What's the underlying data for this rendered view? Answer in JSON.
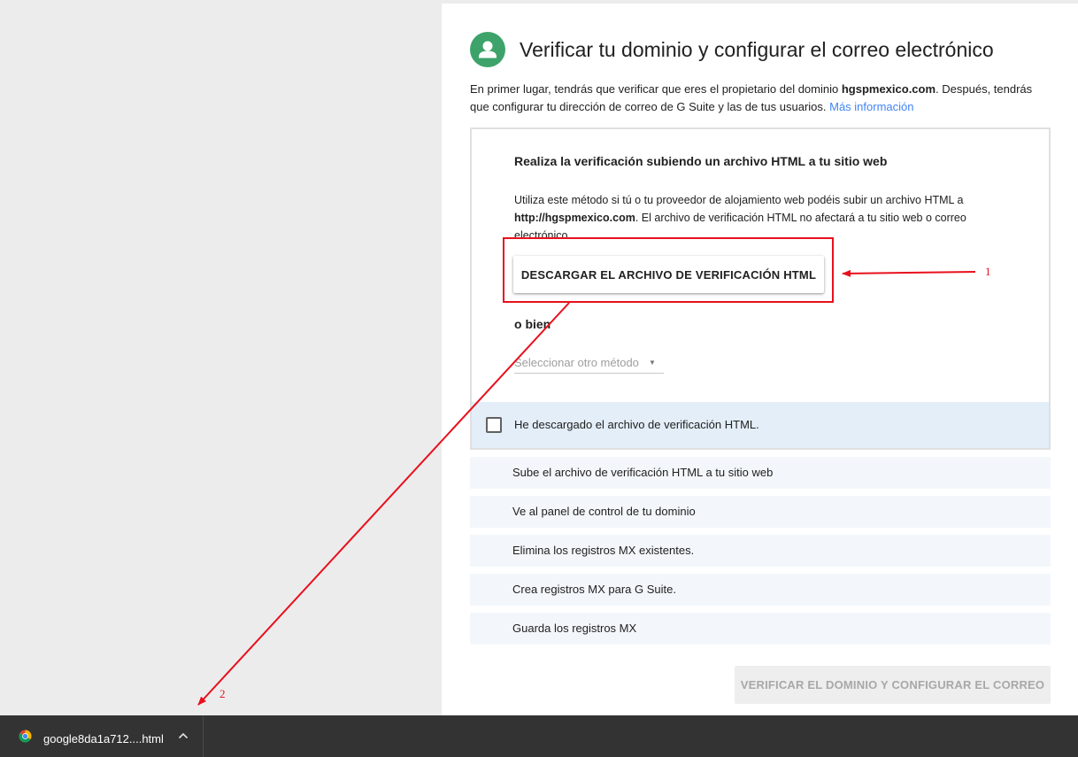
{
  "header": {
    "title": "Verificar tu dominio y configurar el correo electrónico"
  },
  "intro": {
    "text_part1": "En primer lugar, tendrás que verificar que eres el propietario del dominio ",
    "domain": "hgspmexico.com",
    "text_part2": ". Después, tendrás que configurar tu dirección de correo de G Suite y las de tus usuarios. ",
    "link": "Más información"
  },
  "card": {
    "title": "Realiza la verificación subiendo un archivo HTML a tu sitio web",
    "desc_part1": "Utiliza este método si tú o tu proveedor de alojamiento web podéis subir un archivo HTML a ",
    "desc_url": "http://hgspmexico.com",
    "desc_part2": ". El archivo de verificación HTML no afectará a tu sitio web o correo electrónico.",
    "download_button": "DESCARGAR EL ARCHIVO DE VERIFICACIÓN HTML",
    "or_label": "o bien",
    "select_placeholder": "Seleccionar otro método",
    "select_caret": "▼",
    "checkbox_label": "He descargado el archivo de verificación HTML."
  },
  "steps": [
    "Sube el archivo de verificación HTML a tu sitio web",
    "Ve al panel de control de tu dominio",
    "Elimina los registros MX existentes.",
    "Crea registros MX para G Suite.",
    "Guarda los registros MX"
  ],
  "verify_button": "VERIFICAR EL DOMINIO Y CONFIGURAR EL CORREO",
  "download_bar": {
    "file_name": "google8da1a712....html",
    "icon": "chrome-icon"
  },
  "annotations": {
    "label_1": "1",
    "label_2": "2",
    "color": "#e8101d"
  },
  "colors": {
    "avatar": "#3da36a",
    "link": "#4285f4",
    "confirm_bg": "#e3eef8",
    "step_bg": "#f3f7fb"
  }
}
